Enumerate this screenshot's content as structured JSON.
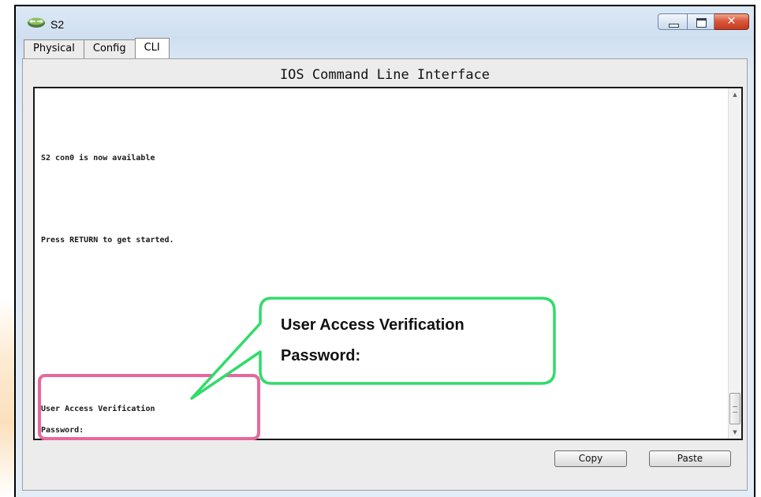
{
  "window": {
    "title": "S2",
    "icon": "switch-device-icon"
  },
  "tabs": [
    {
      "label": "Physical"
    },
    {
      "label": "Config"
    },
    {
      "label": "CLI"
    }
  ],
  "panel": {
    "title": "IOS Command Line Interface"
  },
  "cli": {
    "line1": "S2 con0 is now available",
    "line2": "Press RETURN to get started.",
    "line3": "User Access Verification",
    "line4": "Password:"
  },
  "buttons": {
    "copy": "Copy",
    "paste": "Paste"
  },
  "callout": {
    "line1": "User Access Verification",
    "line2": "Password:"
  },
  "colors": {
    "callout_border": "#2fdc6a",
    "highlight_border": "#e8679a"
  }
}
